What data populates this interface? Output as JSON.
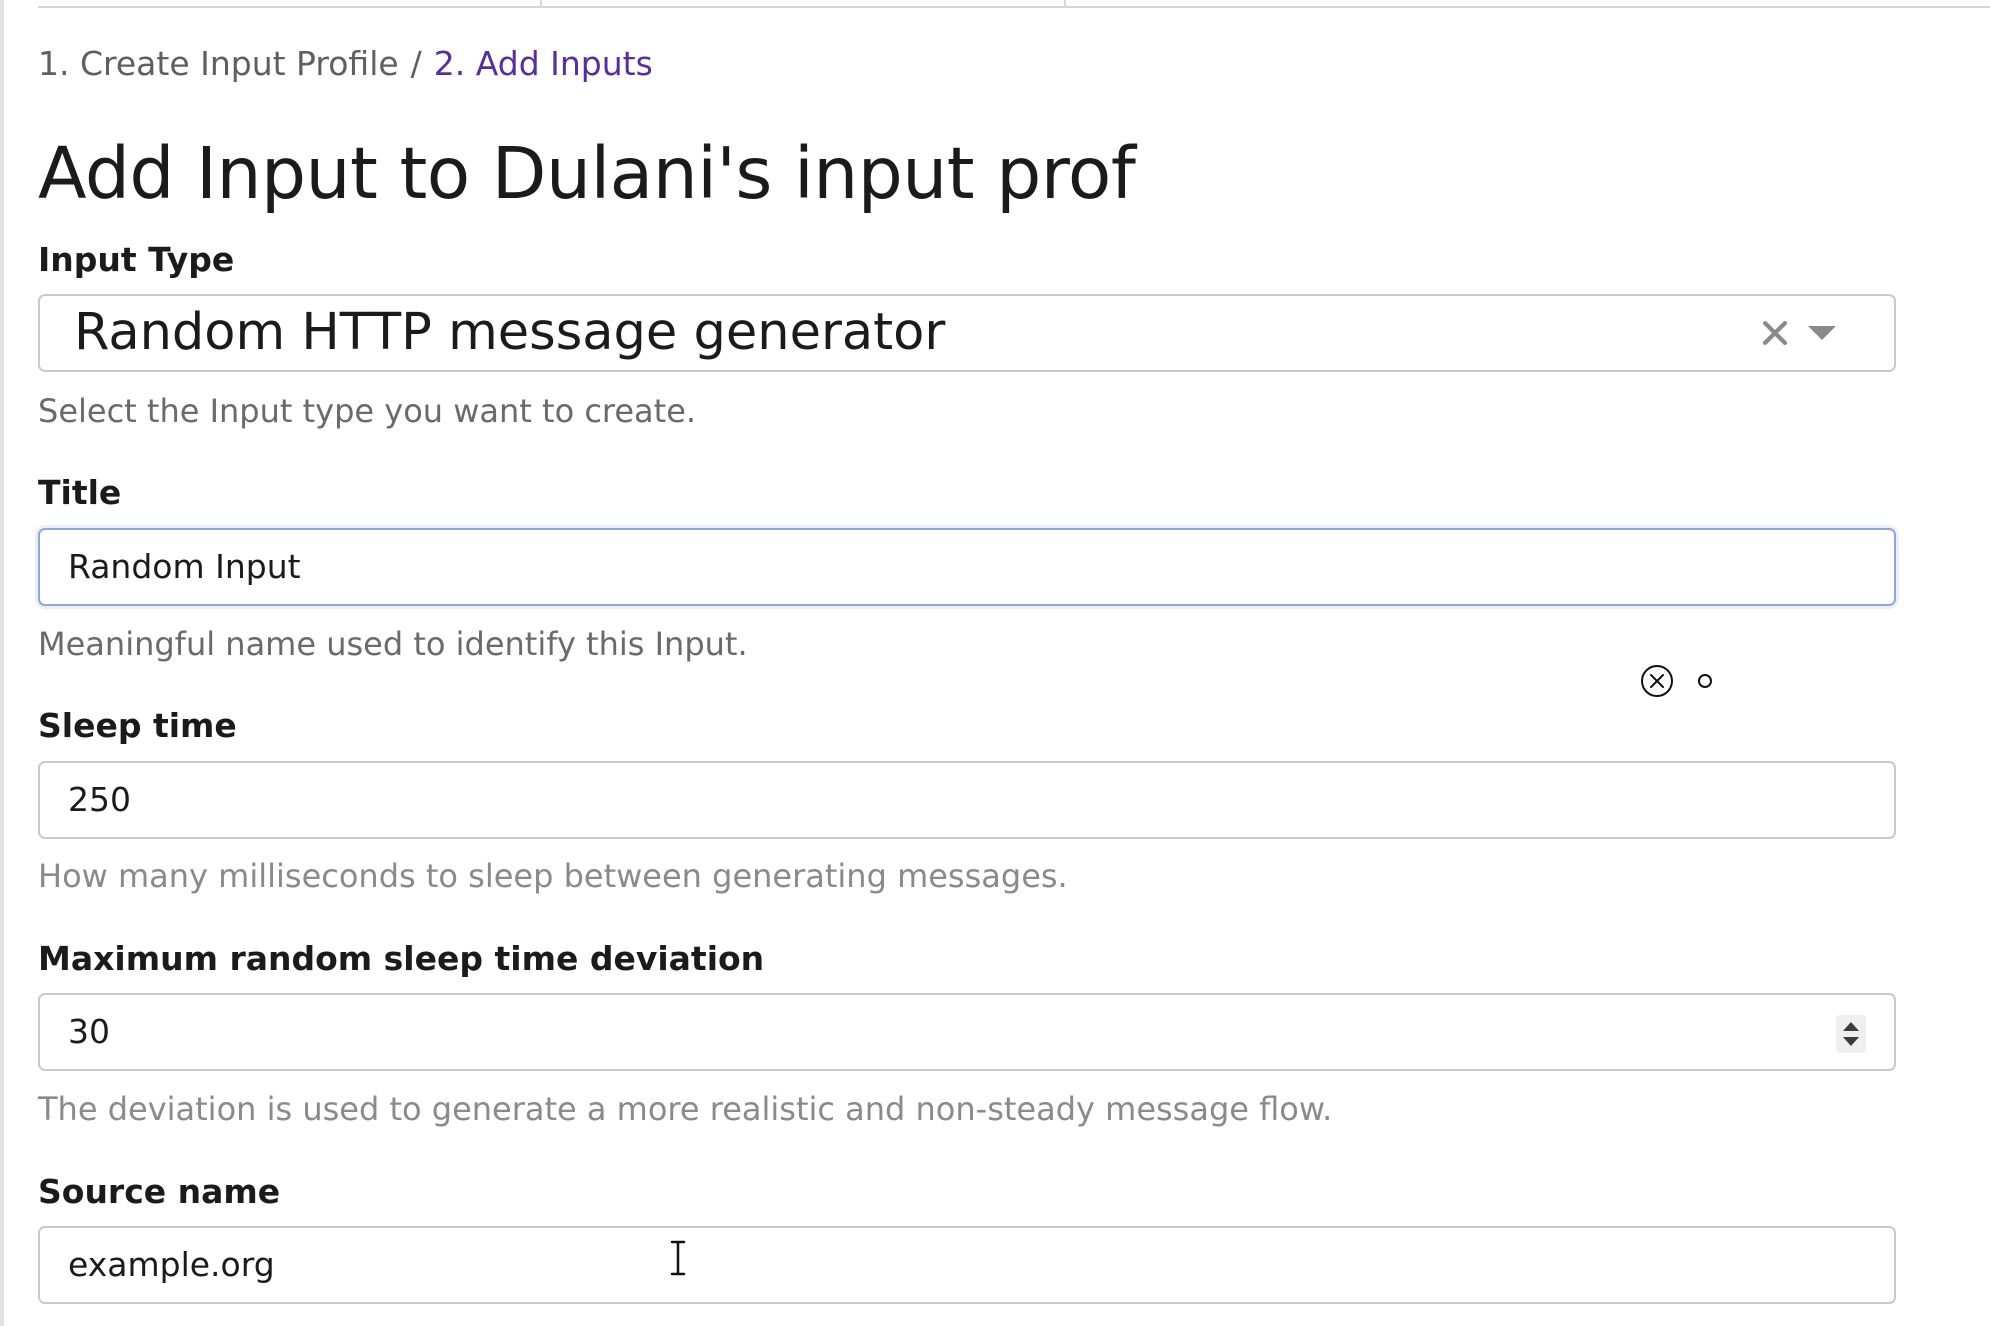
{
  "breadcrumb": {
    "step1": "1. Create Input Profile",
    "separator": "/",
    "step2": "2. Add Inputs"
  },
  "page": {
    "title": "Add Input to Dulani's input prof"
  },
  "input_type": {
    "label": "Input Type",
    "value": "Random HTTP message generator",
    "clear_icon": "close-icon",
    "dropdown_icon": "chevron-down-icon",
    "help": "Select the Input type you want to create."
  },
  "title_field": {
    "label": "Title",
    "value": "Random Input",
    "help": "Meaningful name used to identify this Input."
  },
  "sleep_time": {
    "label": "Sleep time",
    "value": "250",
    "help": "How many milliseconds to sleep between generating messages."
  },
  "deviation": {
    "label": "Maximum random sleep time deviation",
    "value": "30",
    "help": "The deviation is used to generate a more realistic and non-steady message flow."
  },
  "source_name": {
    "label": "Source name",
    "value": "example.org"
  },
  "colors": {
    "accent": "#5a2ca0",
    "help_text": "#6a6a6a",
    "border": "#c9c9c9",
    "focus_border": "#8fa6d8"
  }
}
